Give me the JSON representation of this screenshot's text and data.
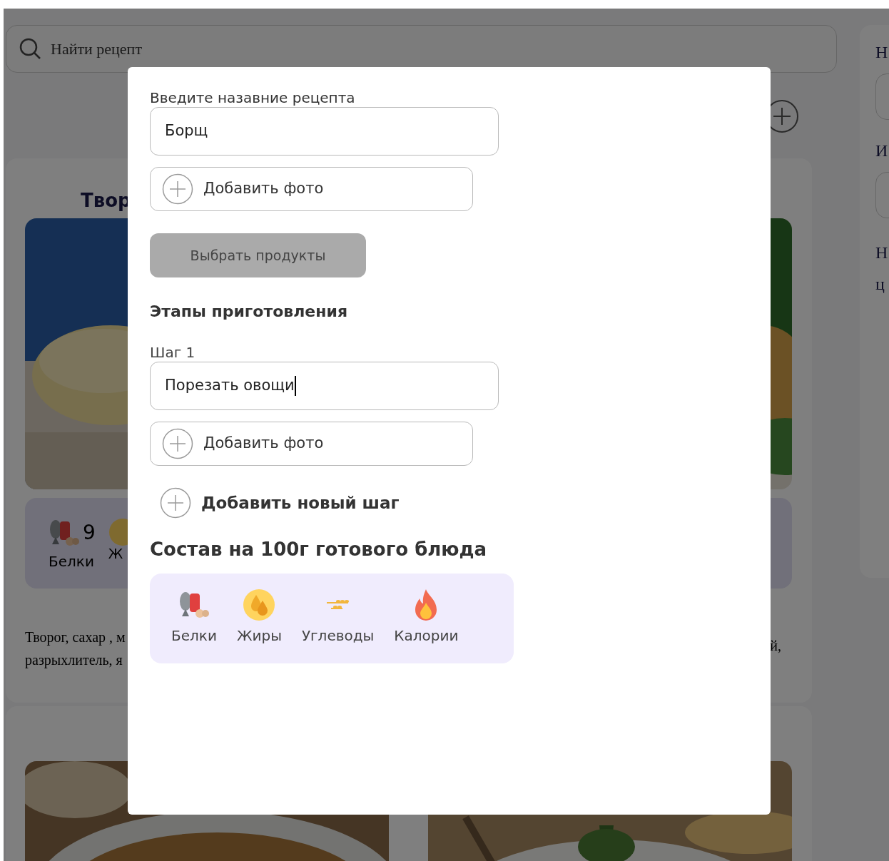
{
  "background": {
    "search": {
      "placeholder": "Найти рецепт"
    },
    "recipe_card": {
      "title": "Твор",
      "nutrition": {
        "value": "9",
        "label": "Белки",
        "label_2": "Ж"
      },
      "description_lines": [
        "Творог, сахар , м",
        "разрыхлитель, я"
      ],
      "right_description_tail": "й,"
    },
    "sidebar": {
      "labels": [
        "Н",
        "И",
        "Н",
        "ц"
      ]
    }
  },
  "modal": {
    "name_label": "Введите назавние рецепта",
    "name_field": {
      "value": "Борщ",
      "focused": false
    },
    "add_photo": "Добавить фото",
    "select_products": "Выбрать продукты",
    "steps_heading": "Этапы приготовления",
    "steps": [
      {
        "label": "Шаг 1",
        "value": "Порезать овощи",
        "focused": true,
        "add_photo": "Добавить фото"
      }
    ],
    "add_step": "Добавить новый шаг",
    "composition_heading": "Состав на 100г готового блюда",
    "nutrients": [
      {
        "kind": "protein",
        "label": "Белки"
      },
      {
        "kind": "fat",
        "label": "Жиры"
      },
      {
        "kind": "carbs",
        "label": "Углеводы"
      },
      {
        "kind": "calories",
        "label": "Калории"
      }
    ]
  }
}
